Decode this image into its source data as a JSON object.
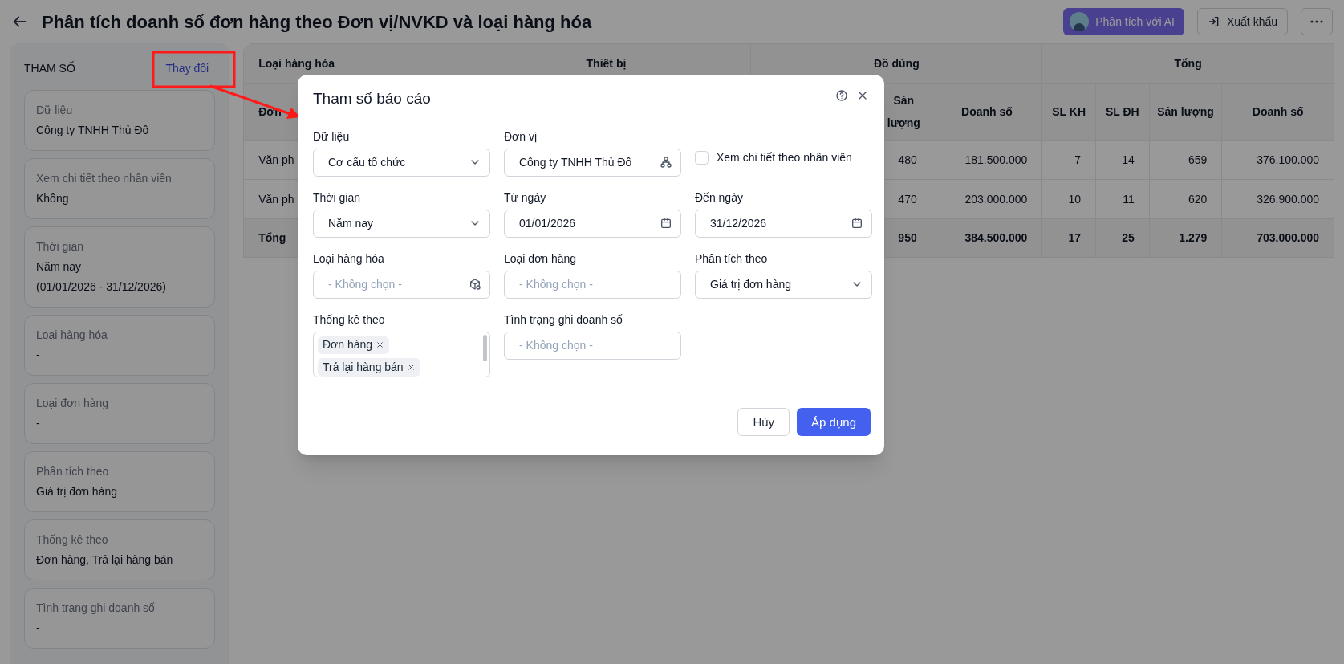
{
  "header": {
    "title": "Phân tích doanh số đơn hàng theo Đơn vị/NVKD và loại hàng hóa",
    "ai_button": "Phân tích với AI",
    "export_button": "Xuất khẩu"
  },
  "params_panel": {
    "title": "THAM SỐ",
    "change_link": "Thay đổi",
    "items": [
      {
        "label": "Dữ liệu",
        "value": "Công ty TNHH Thủ Đô"
      },
      {
        "label": "Xem chi tiết theo nhân viên",
        "value": "Không"
      },
      {
        "label": "Thời gian",
        "value": "Năm nay",
        "value_2": "(01/01/2026 - 31/12/2026)"
      },
      {
        "label": "Loại hàng hóa",
        "value": "-"
      },
      {
        "label": "Loại đơn hàng",
        "value": "-"
      },
      {
        "label": "Phân tích theo",
        "value": "Giá trị đơn hàng"
      },
      {
        "label": "Thống kê theo",
        "value": "Đơn hàng, Trả lại hàng bán"
      },
      {
        "label": "Tình trạng ghi doanh số",
        "value": "-"
      }
    ]
  },
  "table": {
    "corner": "Loại hàng hóa",
    "row_header": "Đơn",
    "groups": [
      {
        "label": "Thiết bị"
      },
      {
        "label": "Đồ dùng",
        "columns": [
          "Sản lượng",
          "Doanh số"
        ]
      },
      {
        "label": "Tổng",
        "columns": [
          "SL KH",
          "SL ĐH",
          "Sản lượng",
          "Doanh số"
        ]
      }
    ],
    "rows": [
      {
        "kind": "data",
        "label": "Văn ph",
        "groups": [
          [
            "480",
            "181.500.000"
          ],
          [
            "7",
            "14",
            "659",
            "376.100.000"
          ]
        ]
      },
      {
        "kind": "data",
        "label": "Văn ph",
        "groups": [
          [
            "470",
            "203.000.000"
          ],
          [
            "10",
            "11",
            "620",
            "326.900.000"
          ]
        ]
      },
      {
        "kind": "total",
        "label": "Tổng",
        "groups": [
          [
            "950",
            "384.500.000"
          ],
          [
            "17",
            "25",
            "1.279",
            "703.000.000"
          ]
        ]
      }
    ]
  },
  "modal": {
    "title": "Tham số báo cáo",
    "fields": [
      {
        "kind": "select",
        "label": "Dữ liệu",
        "value": "Cơ cấu tổ chức"
      },
      {
        "kind": "org_picker",
        "label": "Đơn vị",
        "value": "Công ty TNHH Thủ Đô"
      },
      {
        "kind": "checkbox",
        "label": "Xem chi tiết theo nhân viên",
        "checked": false
      },
      {
        "kind": "select",
        "label": "Thời gian",
        "value": "Năm nay"
      },
      {
        "kind": "date",
        "label": "Từ ngày",
        "value": "01/01/2026"
      },
      {
        "kind": "date",
        "label": "Đến ngày",
        "value": "31/12/2026"
      },
      {
        "kind": "product_picker",
        "label": "Loại hàng hóa",
        "placeholder": "- Không chọn -"
      },
      {
        "kind": "text",
        "label": "Loại đơn hàng",
        "placeholder": "- Không chọn -"
      },
      {
        "kind": "select",
        "label": "Phân tích theo",
        "value": "Giá trị đơn hàng"
      },
      {
        "kind": "tags",
        "label": "Thống kê theo",
        "tags": [
          "Đơn hàng",
          "Trả lại hàng bán"
        ]
      },
      {
        "kind": "text",
        "label": "Tình trạng ghi doanh số",
        "placeholder": "- Không chọn -"
      }
    ],
    "cancel_button": "Hủy",
    "apply_button": "Áp dụng"
  }
}
